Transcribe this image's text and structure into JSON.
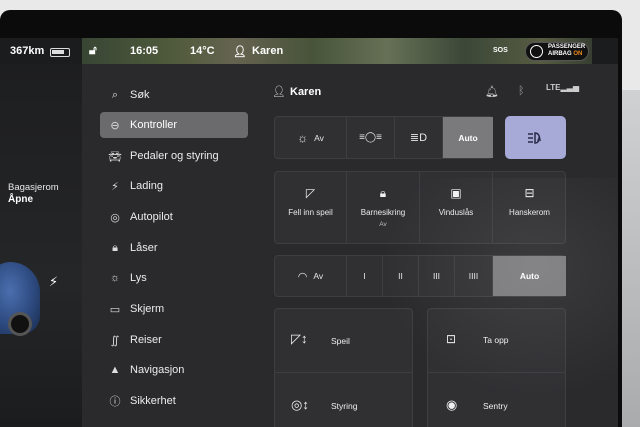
{
  "status": {
    "range": "367km",
    "time": "16:05",
    "temperature": "14°C",
    "user": "Karen",
    "sos": "SOS",
    "airbag_line1": "PASSENGER",
    "airbag_line2": "AIRBAG",
    "airbag_state": "ON"
  },
  "car": {
    "trunk_label": "Bagasjerom",
    "trunk_value": "Åpne"
  },
  "menu": {
    "items": [
      {
        "label": "Søk",
        "icon": "search-icon"
      },
      {
        "label": "Kontroller",
        "icon": "toggle-icon"
      },
      {
        "label": "Pedaler og styring",
        "icon": "car-icon"
      },
      {
        "label": "Lading",
        "icon": "bolt-icon"
      },
      {
        "label": "Autopilot",
        "icon": "steering-wheel-icon"
      },
      {
        "label": "Låser",
        "icon": "lock-icon"
      },
      {
        "label": "Lys",
        "icon": "sun-icon"
      },
      {
        "label": "Skjerm",
        "icon": "display-icon"
      },
      {
        "label": "Reiser",
        "icon": "trips-icon"
      },
      {
        "label": "Navigasjon",
        "icon": "navigation-icon"
      },
      {
        "label": "Sikkerhet",
        "icon": "info-icon"
      }
    ],
    "active_index": 1
  },
  "header": {
    "user": "Karen"
  },
  "lights": {
    "off_label": "Av",
    "auto_label": "Auto",
    "selected": "Auto"
  },
  "quick": {
    "tiles": [
      {
        "label": "Fell inn speil",
        "sub": ""
      },
      {
        "label": "Barnesikring",
        "sub": "Av"
      },
      {
        "label": "Vinduslås",
        "sub": ""
      },
      {
        "label": "Hanskerom",
        "sub": ""
      }
    ]
  },
  "wipers": {
    "off_label": "Av",
    "speeds": [
      "I",
      "II",
      "III",
      "IIII"
    ],
    "auto_label": "Auto",
    "selected": "Auto"
  },
  "adjust": {
    "mirrors_label": "Speil",
    "steering_label": "Styring",
    "record_label": "Ta opp",
    "sentry_label": "Sentry"
  },
  "colors": {
    "accent_selected": "#a7a9d6",
    "active_menu": "#6b6b6d",
    "airbag_on": "#f08a1c"
  }
}
